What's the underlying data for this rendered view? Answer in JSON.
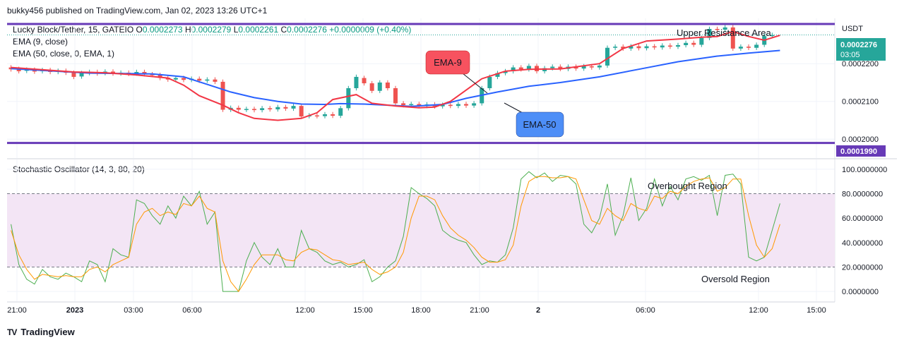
{
  "header": {
    "published": "bukky456 published on TradingView.com, Jan 02, 2023 13:26 UTC+1"
  },
  "legend": {
    "symbol": "Lucky Block/Tether, 15, GATEIO",
    "o_label": "O",
    "o_value": "0.0002273",
    "h_label": "H",
    "h_value": "0.0002279",
    "l_label": "L",
    "l_value": "0.0002261",
    "c_label": "C",
    "c_value": "0.0002276",
    "change": "+0.0000009 (+0.40%)",
    "ema9": "EMA (9, close)",
    "ema50": "EMA (50, close, 0, EMA, 1)"
  },
  "osc_legend": "Stochastic Oscillator (14, 3, 80, 20)",
  "annotations": {
    "upper_resistance": "Upper Resistance Area",
    "ema9_callout": "EMA-9",
    "ema50_callout": "EMA-50",
    "overbought": "Overbought Region",
    "oversold": "Oversold Region"
  },
  "price_axis": {
    "currency": "USDT",
    "current_price": "0.0002276",
    "countdown": "03:05",
    "ticks": [
      "0.0002200",
      "0.0002100",
      "0.0002000"
    ],
    "support_label": "0.0001990"
  },
  "osc_axis": {
    "ticks": [
      "100.0000000",
      "80.0000000",
      "60.0000000",
      "40.0000000",
      "20.0000000",
      "0.0000000"
    ]
  },
  "time_axis": {
    "ticks": [
      "21:00",
      "2023",
      "03:00",
      "06:00",
      "12:00",
      "15:00",
      "18:00",
      "21:00",
      "2",
      "06:00",
      "12:00",
      "15:00"
    ]
  },
  "footer": {
    "brand": "TradingView"
  },
  "colors": {
    "up": "#26a69a",
    "down": "#ef5350",
    "ema9": "#f23645",
    "ema50": "#2962ff",
    "levels": "#673ab7",
    "k_line": "#4caf50",
    "d_line": "#ff9800",
    "band": "#f3e5f5"
  },
  "chart_data": [
    {
      "type": "candlestick",
      "title": "Lucky Block/Tether, 15, GATEIO",
      "ylim": [
        0.000195,
        0.000232
      ],
      "resistance_level": 0.0002305,
      "support_level": 0.000199,
      "ema9_path": [
        [
          0,
          0.000219
        ],
        [
          8,
          0.0002178
        ],
        [
          12,
          0.0002176
        ],
        [
          16,
          0.000217
        ],
        [
          20,
          0.0002162
        ],
        [
          22,
          0.0002143
        ],
        [
          24,
          0.0002115
        ],
        [
          27,
          0.000209
        ],
        [
          29,
          0.000207
        ],
        [
          31,
          0.0002055
        ],
        [
          34,
          0.000205
        ],
        [
          37,
          0.0002055
        ],
        [
          39,
          0.000207
        ],
        [
          41,
          0.0002105
        ],
        [
          44,
          0.0002118
        ],
        [
          46,
          0.0002095
        ],
        [
          49,
          0.0002088
        ],
        [
          52,
          0.0002083
        ],
        [
          54,
          0.0002085
        ],
        [
          56,
          0.00021
        ],
        [
          58,
          0.000213
        ],
        [
          60,
          0.000216
        ],
        [
          63,
          0.000218
        ],
        [
          66,
          0.0002185
        ],
        [
          70,
          0.0002186
        ],
        [
          75,
          0.00022
        ],
        [
          78,
          0.000224
        ],
        [
          81,
          0.000226
        ],
        [
          85,
          0.0002265
        ],
        [
          88,
          0.000227
        ],
        [
          90,
          0.0002272
        ],
        [
          92,
          0.0002285
        ],
        [
          94,
          0.0002272
        ],
        [
          96,
          0.0002262
        ],
        [
          98,
          0.0002275
        ]
      ],
      "ema50_path": [
        [
          0,
          0.0002187
        ],
        [
          10,
          0.0002175
        ],
        [
          18,
          0.0002173
        ],
        [
          22,
          0.0002165
        ],
        [
          25,
          0.0002145
        ],
        [
          28,
          0.0002125
        ],
        [
          31,
          0.000211
        ],
        [
          34,
          0.00021
        ],
        [
          37,
          0.0002093
        ],
        [
          40,
          0.0002092
        ],
        [
          42,
          0.0002094
        ],
        [
          45,
          0.0002093
        ],
        [
          48,
          0.000209
        ],
        [
          51,
          0.0002087
        ],
        [
          55,
          0.0002092
        ],
        [
          58,
          0.0002108
        ],
        [
          62,
          0.0002125
        ],
        [
          66,
          0.000214
        ],
        [
          70,
          0.000215
        ],
        [
          75,
          0.0002165
        ],
        [
          80,
          0.0002185
        ],
        [
          85,
          0.0002205
        ],
        [
          90,
          0.000222
        ],
        [
          94,
          0.0002228
        ],
        [
          98,
          0.0002235
        ]
      ],
      "candles": [
        [
          0.000219,
          0.0002185
        ],
        [
          0.0002186,
          0.000218
        ],
        [
          0.0002181,
          0.0002184
        ],
        [
          0.0002184,
          0.0002179
        ],
        [
          0.000218,
          0.0002183
        ],
        [
          0.0002183,
          0.0002178
        ],
        [
          0.0002178,
          0.0002181
        ],
        [
          0.0002181,
          0.0002176
        ],
        [
          0.0002176,
          0.0002165
        ],
        [
          0.0002166,
          0.0002175
        ],
        [
          0.0002175,
          0.0002178
        ],
        [
          0.0002178,
          0.0002174
        ],
        [
          0.0002175,
          0.0002179
        ],
        [
          0.0002179,
          0.0002174
        ],
        [
          0.0002174,
          0.0002176
        ],
        [
          0.0002176,
          0.0002173
        ],
        [
          0.0002174,
          0.0002178
        ],
        [
          0.0002178,
          0.0002172
        ],
        [
          0.0002172,
          0.000217
        ],
        [
          0.000217,
          0.0002162
        ],
        [
          0.0002163,
          0.0002158
        ],
        [
          0.0002158,
          0.0002162
        ],
        [
          0.0002162,
          0.0002157
        ],
        [
          0.0002157,
          0.000216
        ],
        [
          0.000216,
          0.0002155
        ],
        [
          0.0002155,
          0.0002158
        ],
        [
          0.0002158,
          0.0002152
        ],
        [
          0.0002152,
          0.0002078
        ],
        [
          0.0002078,
          0.0002083
        ],
        [
          0.0002083,
          0.0002078
        ],
        [
          0.0002078,
          0.000208
        ],
        [
          0.000208,
          0.0002077
        ],
        [
          0.0002077,
          0.0002082
        ],
        [
          0.0002082,
          0.0002079
        ],
        [
          0.0002079,
          0.0002085
        ],
        [
          0.0002085,
          0.0002081
        ],
        [
          0.0002081,
          0.0002088
        ],
        [
          0.0002088,
          0.000206
        ],
        [
          0.0002061,
          0.0002063
        ],
        [
          0.0002063,
          0.0002061
        ],
        [
          0.0002061,
          0.0002066
        ],
        [
          0.0002066,
          0.0002062
        ],
        [
          0.0002062,
          0.0002082
        ],
        [
          0.0002082,
          0.0002135
        ],
        [
          0.0002135,
          0.0002165
        ],
        [
          0.0002162,
          0.0002148
        ],
        [
          0.0002148,
          0.0002128
        ],
        [
          0.0002128,
          0.000215
        ],
        [
          0.000215,
          0.0002135
        ],
        [
          0.0002135,
          0.0002095
        ],
        [
          0.0002095,
          0.000209
        ],
        [
          0.000209,
          0.0002093
        ],
        [
          0.0002093,
          0.0002088
        ],
        [
          0.0002088,
          0.0002092
        ],
        [
          0.0002092,
          0.0002087
        ],
        [
          0.0002087,
          0.0002091
        ],
        [
          0.0002091,
          0.0002088
        ],
        [
          0.0002088,
          0.0002093
        ],
        [
          0.0002093,
          0.0002089
        ],
        [
          0.0002089,
          0.0002095
        ],
        [
          0.0002095,
          0.0002135
        ],
        [
          0.0002135,
          0.0002165
        ],
        [
          0.0002165,
          0.0002175
        ],
        [
          0.0002175,
          0.000218
        ],
        [
          0.000218,
          0.000219
        ],
        [
          0.000219,
          0.0002185
        ],
        [
          0.0002185,
          0.0002194
        ],
        [
          0.0002194,
          0.000218
        ],
        [
          0.000218,
          0.0002188
        ],
        [
          0.0002188,
          0.0002192
        ],
        [
          0.0002192,
          0.0002186
        ],
        [
          0.0002186,
          0.0002192
        ],
        [
          0.0002192,
          0.0002187
        ],
        [
          0.0002187,
          0.0002193
        ],
        [
          0.0002193,
          0.000219
        ],
        [
          0.000219,
          0.0002195
        ],
        [
          0.0002195,
          0.0002242
        ],
        [
          0.0002242,
          0.0002245
        ],
        [
          0.0002245,
          0.000224
        ],
        [
          0.000224,
          0.0002246
        ],
        [
          0.0002246,
          0.0002241
        ],
        [
          0.0002241,
          0.0002246
        ],
        [
          0.0002246,
          0.0002243
        ],
        [
          0.0002243,
          0.0002248
        ],
        [
          0.0002248,
          0.0002245
        ],
        [
          0.0002245,
          0.0002249
        ],
        [
          0.0002249,
          0.0002255
        ],
        [
          0.0002255,
          0.000225
        ],
        [
          0.000225,
          0.0002268
        ],
        [
          0.0002268,
          0.0002292
        ],
        [
          0.0002292,
          0.000229
        ],
        [
          0.000229,
          0.0002296
        ],
        [
          0.0002296,
          0.000224
        ],
        [
          0.000224,
          0.0002245
        ],
        [
          0.0002245,
          0.0002242
        ],
        [
          0.0002242,
          0.000225
        ],
        [
          0.000225,
          0.0002273
        ],
        [
          0.0002273,
          0.0002276
        ]
      ]
    },
    {
      "type": "line",
      "title": "Stochastic Oscillator (14, 3, 80, 20)",
      "ylim": [
        -8,
        108
      ],
      "levels": [
        80,
        20
      ],
      "series": [
        {
          "values": [
            55,
            22,
            10,
            6,
            18,
            12,
            10,
            15,
            12,
            8,
            25,
            22,
            8,
            35,
            30,
            28,
            75,
            72,
            62,
            55,
            70,
            60,
            78,
            70,
            82,
            55,
            65,
            0,
            0,
            0,
            25,
            40,
            28,
            22,
            35,
            20,
            20,
            50,
            35,
            32,
            25,
            22,
            24,
            20,
            22,
            26,
            8,
            12,
            20,
            25,
            45,
            85,
            80,
            76,
            70,
            50,
            45,
            42,
            40,
            30,
            22,
            25,
            24,
            30,
            52,
            92,
            98,
            93,
            97,
            90,
            95,
            94,
            88,
            55,
            48,
            60,
            88,
            46,
            62,
            93,
            58,
            68,
            92,
            70,
            86,
            75,
            92,
            94,
            91,
            95,
            62,
            95,
            96,
            88,
            28,
            25,
            28,
            50,
            72
          ]
        },
        {
          "values": [
            50,
            30,
            18,
            10,
            14,
            13,
            12,
            13,
            12,
            12,
            18,
            20,
            16,
            22,
            25,
            28,
            55,
            65,
            68,
            62,
            65,
            63,
            72,
            70,
            78,
            68,
            65,
            25,
            8,
            0,
            10,
            22,
            30,
            30,
            30,
            26,
            25,
            32,
            35,
            34,
            30,
            26,
            25,
            22,
            23,
            24,
            18,
            14,
            16,
            20,
            32,
            60,
            78,
            78,
            75,
            62,
            52,
            46,
            42,
            36,
            28,
            24,
            24,
            26,
            38,
            70,
            90,
            94,
            94,
            93,
            93,
            94,
            92,
            75,
            58,
            55,
            68,
            62,
            58,
            72,
            68,
            66,
            78,
            76,
            82,
            80,
            86,
            90,
            92,
            93,
            82,
            85,
            92,
            92,
            62,
            38,
            28,
            35,
            55
          ]
        }
      ]
    }
  ]
}
